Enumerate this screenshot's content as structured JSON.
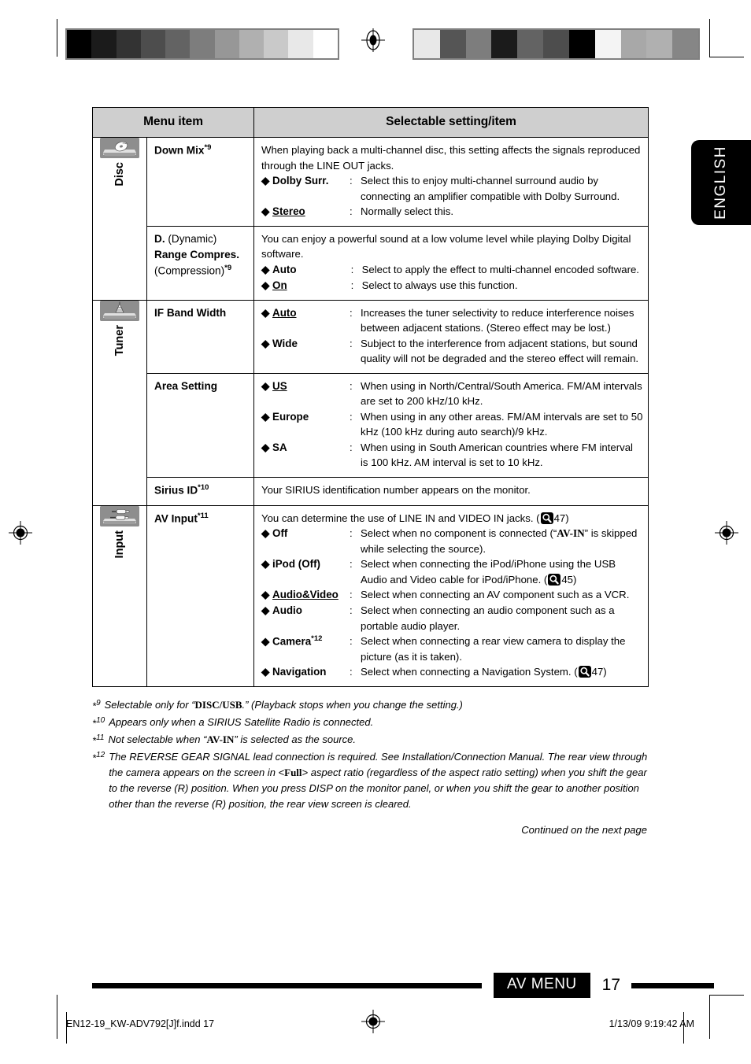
{
  "page": {
    "language_tab": "ENGLISH",
    "number": "17",
    "section_label": "AV MENU",
    "continued_note": "Continued on the next page"
  },
  "table": {
    "headers": {
      "col1": "Menu item",
      "col2": "Selectable setting/item"
    },
    "categories": [
      {
        "id": "disc",
        "label": "Disc",
        "icon": "disc-player-icon"
      },
      {
        "id": "tuner",
        "label": "Tuner",
        "icon": "radio-tower-icon"
      },
      {
        "id": "input",
        "label": "Input",
        "icon": "av-input-jack-icon"
      }
    ],
    "rows": [
      {
        "category": "disc",
        "menu_item": "Down Mix",
        "menu_sup": "*9",
        "intro": "When playing back a multi-channel disc, this setting affects the signals reproduced through the LINE OUT jacks.",
        "options": [
          {
            "label": "Dolby Surr.",
            "underline": false,
            "text": "Select this to enjoy multi-channel surround audio by connecting an amplifier compatible with Dolby Surround."
          },
          {
            "label": "Stereo",
            "underline": true,
            "text": "Normally select this."
          }
        ]
      },
      {
        "category": "disc",
        "menu_item_line1_bold": "D.",
        "menu_item_line1_norm": " (Dynamic)",
        "menu_item_line2_bold": "Range Compres.",
        "menu_item_line3_norm": "(Compression)",
        "menu_sup": "*9",
        "intro": "You can enjoy a powerful sound at a low volume level while playing Dolby Digital software.",
        "options": [
          {
            "label": "Auto",
            "underline": false,
            "text": "Select to apply the effect to multi-channel encoded software."
          },
          {
            "label": "On",
            "underline": true,
            "text": "Select to always use this function."
          }
        ]
      },
      {
        "category": "tuner",
        "menu_item": "IF Band Width",
        "menu_sup": "",
        "intro": "",
        "options": [
          {
            "label": "Auto",
            "underline": true,
            "text": "Increases the tuner selectivity to reduce interference noises between adjacent stations. (Stereo effect may be lost.)"
          },
          {
            "label": "Wide",
            "underline": false,
            "text": "Subject to the interference from adjacent stations, but sound quality will not be degraded and the stereo effect will remain."
          }
        ]
      },
      {
        "category": "tuner",
        "menu_item": "Area Setting",
        "menu_sup": "",
        "intro": "",
        "options": [
          {
            "label": "US",
            "underline": true,
            "text": "When using in North/Central/South America. FM/AM intervals are set to 200 kHz/10 kHz."
          },
          {
            "label": "Europe",
            "underline": false,
            "text": "When using in any other areas. FM/AM intervals are set to 50 kHz (100 kHz during auto search)/9 kHz."
          },
          {
            "label": "SA",
            "underline": false,
            "text": "When using in South American countries where FM interval is 100 kHz. AM interval is set to 10 kHz."
          }
        ]
      },
      {
        "category": "tuner",
        "menu_item": "Sirius ID",
        "menu_sup": "*10",
        "intro": "Your SIRIUS identification number appears on the monitor.",
        "options": []
      },
      {
        "category": "input",
        "menu_item": "AV Input",
        "menu_sup": "*11",
        "intro_pre": "You can determine the use of LINE IN and VIDEO IN jacks. (",
        "intro_ref": "47",
        "intro_post": ")",
        "options": [
          {
            "label": "Off",
            "underline": false,
            "text_pre": "Select when no component is connected (“",
            "text_bold": "AV-IN",
            "text_post": "” is skipped while selecting the source)."
          },
          {
            "label": "iPod (Off)",
            "underline": false,
            "text_pre": "Select when connecting the iPod/iPhone using the USB Audio and Video cable for iPod/iPhone. (",
            "ref": "45",
            "text_post": ")"
          },
          {
            "label": "Audio&Video",
            "underline": true,
            "text": "Select when connecting an AV component such as a VCR."
          },
          {
            "label": "Audio",
            "underline": false,
            "text": "Select when connecting an audio component such as a portable audio player."
          },
          {
            "label": "Camera",
            "sup": "*12",
            "underline": false,
            "text": "Select when connecting a rear view camera to display the picture (as it is taken)."
          },
          {
            "label": "Navigation",
            "underline": false,
            "text_pre": "Select when connecting a Navigation System. (",
            "ref": "47",
            "text_post": ")"
          }
        ]
      }
    ]
  },
  "footnotes": [
    {
      "mark": "*9",
      "pre": "Selectable only for “",
      "bold": "DISC/USB",
      "post": ".” (Playback stops when you change the setting.)"
    },
    {
      "mark": "*10",
      "pre": "Appears only when a SIRIUS Satellite Radio is connected.",
      "bold": "",
      "post": ""
    },
    {
      "mark": "*11",
      "pre": "Not selectable when “",
      "bold": "AV-IN",
      "post": "” is selected as the source."
    },
    {
      "mark": "*12",
      "pre": "The REVERSE GEAR SIGNAL lead connection is required. See Installation/Connection Manual. The rear view through the camera appears on the screen in <",
      "bold": "Full",
      "post": "> aspect ratio (regardless of the aspect ratio setting) when you shift the gear to the reverse (R) position. When you press DISP on the monitor panel, or when you shift the gear to another position other than the reverse (R) position, the rear view screen is cleared."
    }
  ],
  "print_slug": {
    "filename": "EN12-19_KW-ADV792[J]f.indd   17",
    "timestamp": "1/13/09   9:19:42 AM"
  },
  "colorbars": {
    "left": [
      "#000000",
      "#1b1b1b",
      "#333333",
      "#4d4d4d",
      "#636363",
      "#7d7d7d",
      "#979797",
      "#b0b0b0",
      "#c9c9c9",
      "#e8e8e8",
      "#ffffff"
    ],
    "right": [
      "#e8e8e8",
      "#555555",
      "#7d7d7d",
      "#1b1b1b",
      "#636363",
      "#4d4d4d",
      "#000000",
      "#f4f4f4",
      "#a8a8a8",
      "#b0b0b0",
      "#868686"
    ]
  }
}
